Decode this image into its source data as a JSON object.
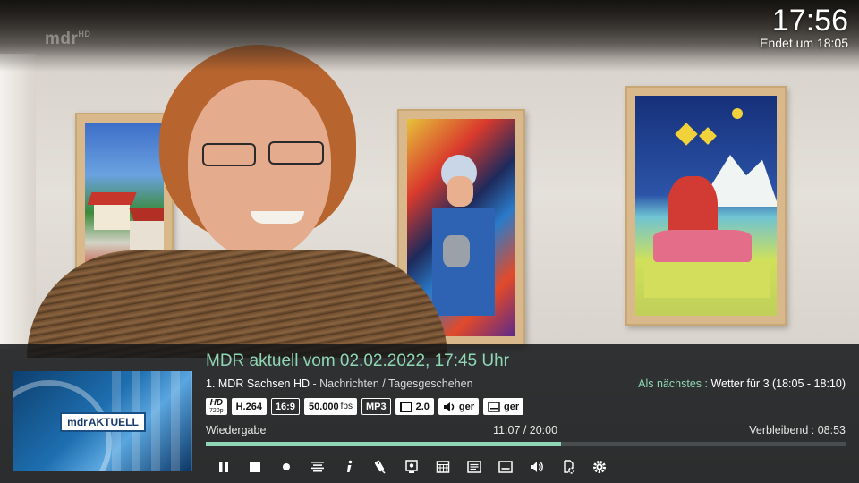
{
  "clock": {
    "time": "17:56",
    "ends": "Endet um 18:05"
  },
  "tv_logo": {
    "text": "mdr",
    "suffix": "HD"
  },
  "thumbnail": {
    "brand": "mdr",
    "show": "AKTUELL"
  },
  "program": {
    "title": "MDR aktuell vom 02.02.2022, 17:45 Uhr",
    "channel": "1. MDR Sachsen HD",
    "separator": " - ",
    "genre": "Nachrichten / Tagesgeschehen"
  },
  "next": {
    "label": "Als nächstes",
    "separator": " : ",
    "value": "Wetter für 3 (18:05 - 18:10)"
  },
  "badges": {
    "hd": "HD",
    "hd_sub": "720p",
    "codec": "H.264",
    "aspect": "16:9",
    "fps_value": "50.000",
    "fps_unit": "fps",
    "audio_codec": "MP3",
    "channels": "2.0",
    "audio_lang": "ger",
    "subtitle_lang": "ger"
  },
  "playback": {
    "status": "Wiedergabe",
    "progress_text": "11:07 / 20:00",
    "progress_fraction": 0.5558,
    "remaining": "Verbleibend : 08:53"
  },
  "controls": [
    {
      "name": "pause-icon"
    },
    {
      "name": "stop-icon"
    },
    {
      "name": "record-icon"
    },
    {
      "name": "chapters-icon"
    },
    {
      "name": "info-icon"
    },
    {
      "name": "remote-icon"
    },
    {
      "name": "screen-settings-icon"
    },
    {
      "name": "epg-grid-icon"
    },
    {
      "name": "teletext-icon"
    },
    {
      "name": "subtitles-icon"
    },
    {
      "name": "volume-icon"
    },
    {
      "name": "file-settings-icon"
    },
    {
      "name": "gear-icon"
    }
  ],
  "colors": {
    "accent": "#8fd6b4",
    "panel": "#141618",
    "track": "#4a4d50"
  }
}
